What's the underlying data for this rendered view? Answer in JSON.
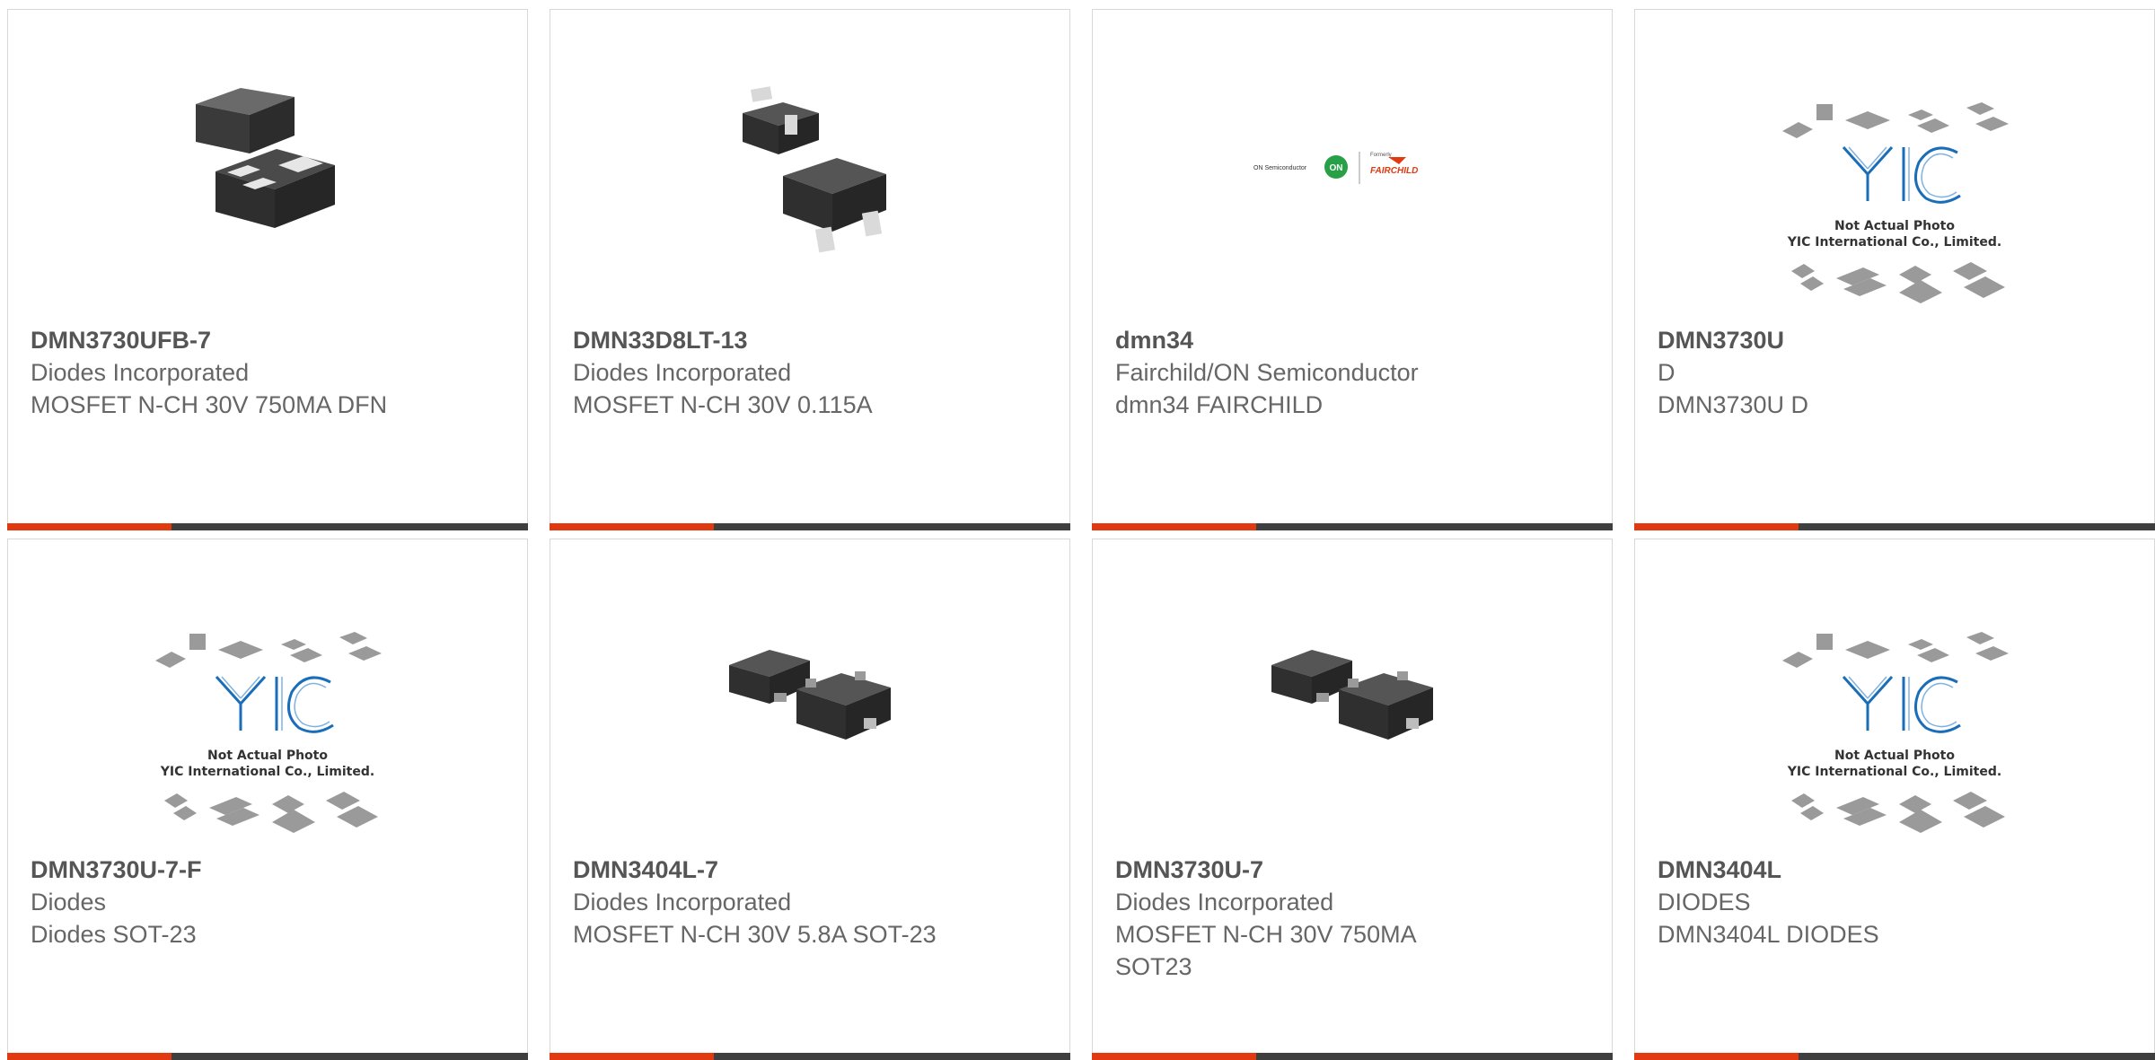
{
  "colors": {
    "accent": "#e23a10",
    "bar_dark": "#3f3f3f",
    "part_number": "#555555",
    "text": "#666666"
  },
  "cards": [
    {
      "part_number": "DMN3730UFB-7",
      "manufacturer": "Diodes Incorporated",
      "description": "MOSFET N-CH 30V 750MA DFN",
      "image": "dfn-package-icon"
    },
    {
      "part_number": "DMN33D8LT-13",
      "manufacturer": "Diodes Incorporated",
      "description": "MOSFET N-CH 30V 0.115A",
      "image": "sot-package-icon"
    },
    {
      "part_number": "dmn34",
      "manufacturer": "Fairchild/ON Semiconductor",
      "description": "dmn34 FAIRCHILD",
      "image": "fairchild-logo",
      "logo": {
        "brand": "ON Semiconductor",
        "mark": "ON",
        "formerly": "Formerly",
        "wordmark": "FAIRCHILD"
      }
    },
    {
      "part_number": "DMN3730U",
      "manufacturer": "D",
      "description": "DMN3730U D",
      "image": "yic-placeholder",
      "placeholder": {
        "line1": "Not Actual Photo",
        "line2": "YIC International Co., Limited."
      }
    },
    {
      "part_number": "DMN3730U-7-F",
      "manufacturer": "Diodes",
      "description": "Diodes SOT-23",
      "image": "yic-placeholder",
      "placeholder": {
        "line1": "Not Actual Photo",
        "line2": "YIC International Co., Limited."
      }
    },
    {
      "part_number": "DMN3404L-7",
      "manufacturer": "Diodes Incorporated",
      "description": "MOSFET N-CH 30V 5.8A SOT-23",
      "image": "sot23-package-icon"
    },
    {
      "part_number": "DMN3730U-7",
      "manufacturer": "Diodes Incorporated",
      "description": "MOSFET N-CH 30V 750MA SOT23",
      "image": "sot23-package-icon"
    },
    {
      "part_number": "DMN3404L",
      "manufacturer": "DIODES",
      "description": "DMN3404L DIODES",
      "image": "yic-placeholder",
      "placeholder": {
        "line1": "Not Actual Photo",
        "line2": "YIC International Co., Limited."
      }
    }
  ]
}
